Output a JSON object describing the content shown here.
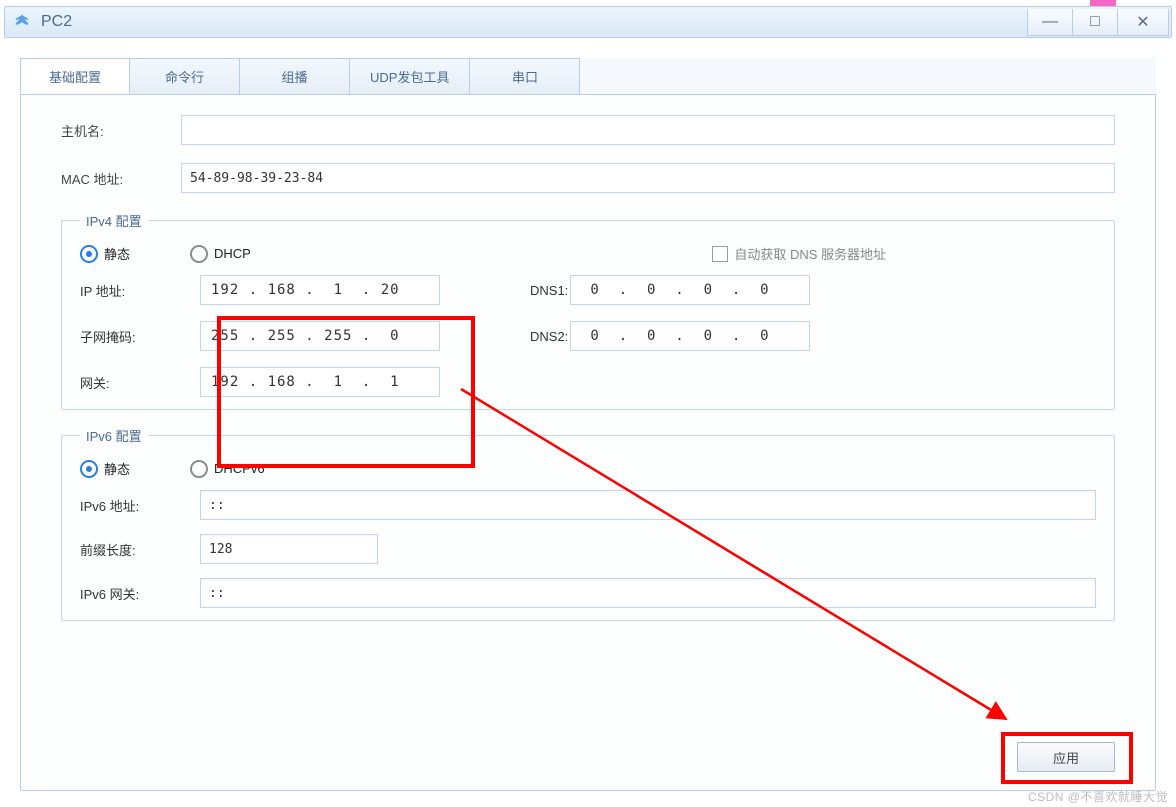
{
  "window": {
    "title": "PC2"
  },
  "tabs": [
    {
      "label": "基础配置",
      "active": true
    },
    {
      "label": "命令行",
      "active": false
    },
    {
      "label": "组播",
      "active": false
    },
    {
      "label": "UDP发包工具",
      "active": false
    },
    {
      "label": "串口",
      "active": false
    }
  ],
  "basic": {
    "host_label": "主机名:",
    "host_value": "",
    "mac_label": "MAC 地址:",
    "mac_value": "54-89-98-39-23-84"
  },
  "ipv4": {
    "legend": "IPv4 配置",
    "static_label": "静态",
    "dhcp_label": "DHCP",
    "auto_dns_label": "自动获取 DNS 服务器地址",
    "ip_label": "IP 地址:",
    "ip_value": "192 . 168 .  1  . 20",
    "mask_label": "子网掩码:",
    "mask_value": "255 . 255 . 255 .  0",
    "gw_label": "网关:",
    "gw_value": "192 . 168 .  1  .  1",
    "dns1_label": "DNS1:",
    "dns1_value": " 0  .  0  .  0  .  0",
    "dns2_label": "DNS2:",
    "dns2_value": " 0  .  0  .  0  .  0"
  },
  "ipv6": {
    "legend": "IPv6 配置",
    "static_label": "静态",
    "dhcp_label": "DHCPv6",
    "addr_label": "IPv6 地址:",
    "addr_value": "::",
    "prefix_label": "前缀长度:",
    "prefix_value": "128",
    "gw_label": "IPv6 网关:",
    "gw_value": "::"
  },
  "apply_label": "应用",
  "watermark": "CSDN @不喜欢就睡大觉"
}
